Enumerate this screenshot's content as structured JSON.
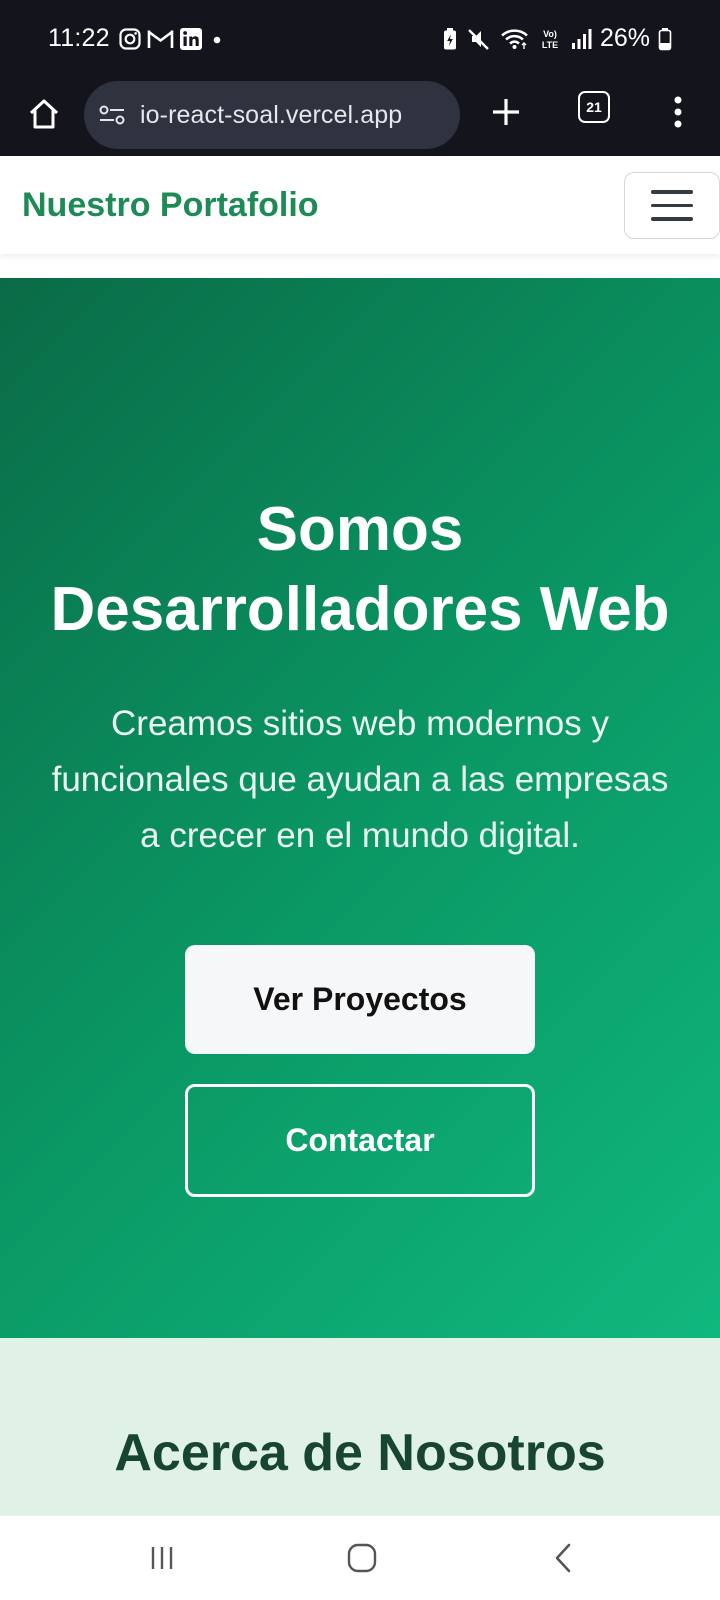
{
  "status_bar": {
    "time": "11:22",
    "notification_icons": [
      "instagram-icon",
      "gmail-icon",
      "linkedin-icon",
      "dot-icon"
    ],
    "system_icons": [
      "battery-saver-icon",
      "mute-icon",
      "wifi-icon",
      "volte-icon",
      "signal-icon"
    ],
    "battery_percent": "26%",
    "volte_label": "Vo) LTE"
  },
  "browser": {
    "url": "io-react-soal.vercel.app",
    "tab_count": "21",
    "icons": [
      "home-icon",
      "site-settings-icon",
      "plus-icon",
      "kebab-menu-icon"
    ]
  },
  "navbar": {
    "brand": "Nuestro Portafolio",
    "toggle_icon": "hamburger-icon"
  },
  "hero": {
    "title_line1": "Somos",
    "title_line2": "Desarrolladores Web",
    "subtitle_line1": "Creamos sitios web modernos y",
    "subtitle_line2": "funcionales que ayudan a las empresas",
    "subtitle_line3": "a crecer en el mundo digital.",
    "primary_button": "Ver Proyectos",
    "secondary_button": "Contactar"
  },
  "about": {
    "title": "Acerca de Nosotros"
  },
  "android_nav": {
    "icons": [
      "recents-icon",
      "home-icon",
      "back-icon"
    ]
  },
  "colors": {
    "brand_green": "#1e8a55",
    "hero_gradient_start": "#0a6b47",
    "hero_gradient_end": "#10b87e",
    "about_bg": "#e0f1e6",
    "about_title": "#17452f"
  }
}
